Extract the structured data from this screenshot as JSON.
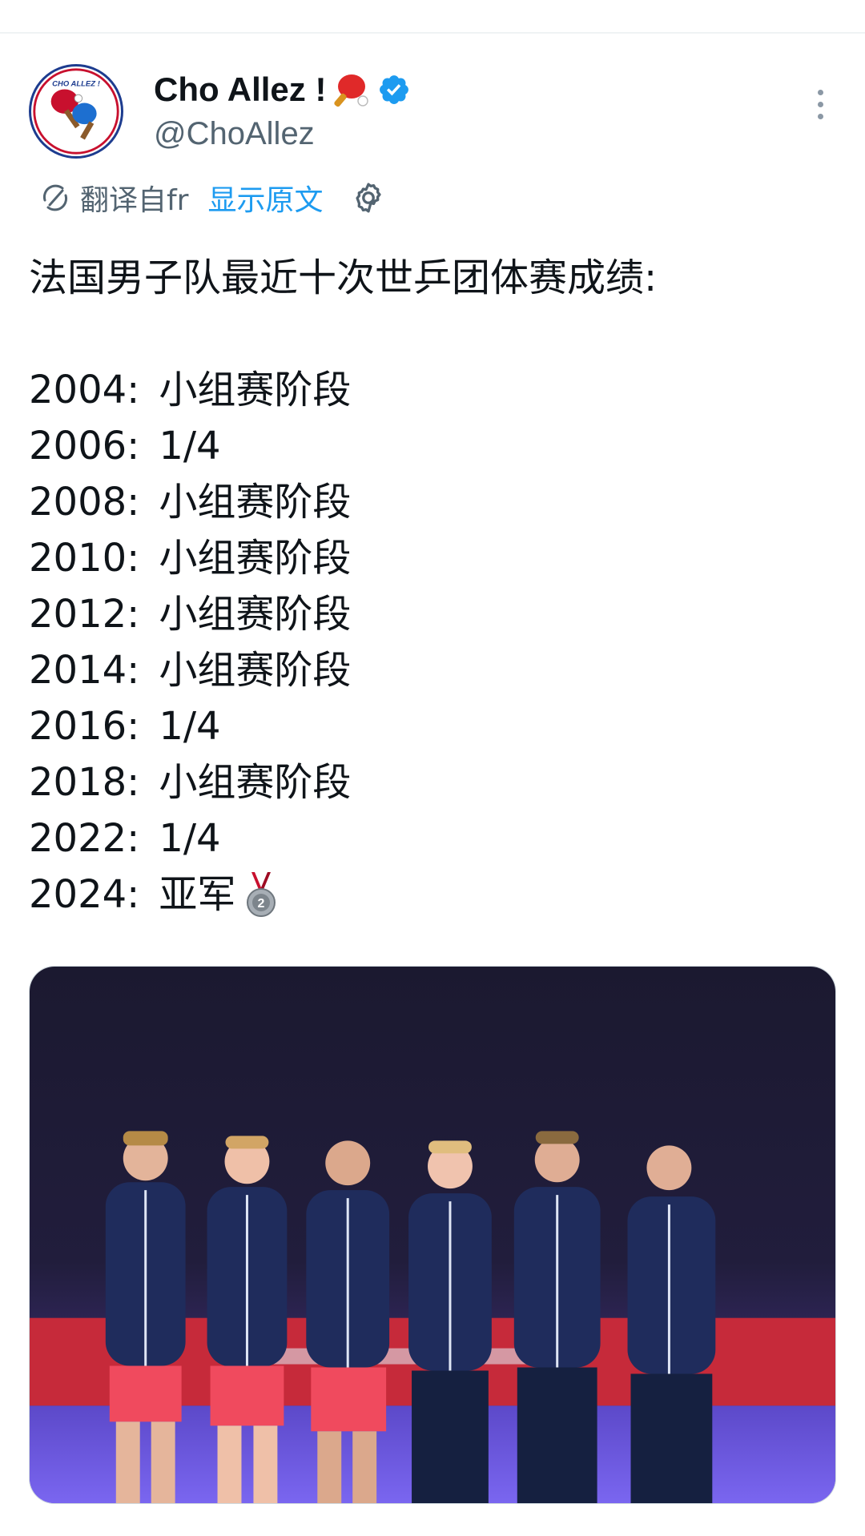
{
  "tweet": {
    "author": {
      "display_name": "Cho Allez !",
      "handle": "@ChoAllez",
      "avatar_text": "CHO ALLEZ !",
      "name_emoji": "ping-pong-paddle-emoji",
      "verified_icon": "verified-badge-icon"
    },
    "translation": {
      "label": "翻译自fr",
      "show_original": "显示原文",
      "settings_icon": "gear-icon"
    },
    "text": {
      "headline": "法国男子队最近十次世乒团体赛成绩:",
      "results": [
        {
          "year": "2004:",
          "result": "小组赛阶段"
        },
        {
          "year": "2006:",
          "result": "1/4"
        },
        {
          "year": "2008:",
          "result": "小组赛阶段"
        },
        {
          "year": "2010:",
          "result": "小组赛阶段"
        },
        {
          "year": "2012:",
          "result": "小组赛阶段"
        },
        {
          "year": "2014:",
          "result": "小组赛阶段"
        },
        {
          "year": "2016:",
          "result": "1/4"
        },
        {
          "year": "2018:",
          "result": "小组赛阶段"
        },
        {
          "year": "2022:",
          "result": "1/4"
        },
        {
          "year": "2024:",
          "result": "亚军",
          "emoji": "silver-medal-icon"
        }
      ]
    },
    "media": {
      "type": "photo",
      "subject": "team-photo"
    }
  },
  "colors": {
    "link": "#1d9bf0",
    "secondary_text": "#536471",
    "verified": "#1d9bf0",
    "divider": "#eff3f4"
  }
}
